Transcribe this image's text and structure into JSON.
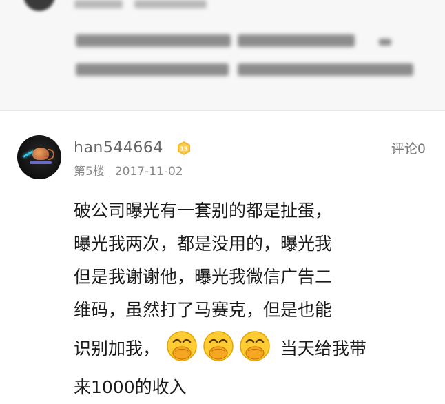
{
  "comment": {
    "username": "han544664",
    "level": "13",
    "floor": "第5楼",
    "date": "2017-11-02",
    "comment_link": "评论0",
    "lines": [
      "破公司曝光有一套别的都是扯蛋，",
      "曝光我两次，都是没用的，曝光我",
      "但是我谢谢他，曝光我微信广告二",
      "维码，虽然打了马赛克，但是也能",
      "识别加我，",
      "当天给我带",
      "来1000的收入"
    ],
    "emoji_count": 3,
    "emoji_icon": "face-with-hand-over-mouth-emoji"
  },
  "colors": {
    "username": "#666666",
    "badge": "#f5b82e",
    "meta": "#888888",
    "body_text": "#1a1a1a",
    "previous_background": "#f7f7f7"
  }
}
